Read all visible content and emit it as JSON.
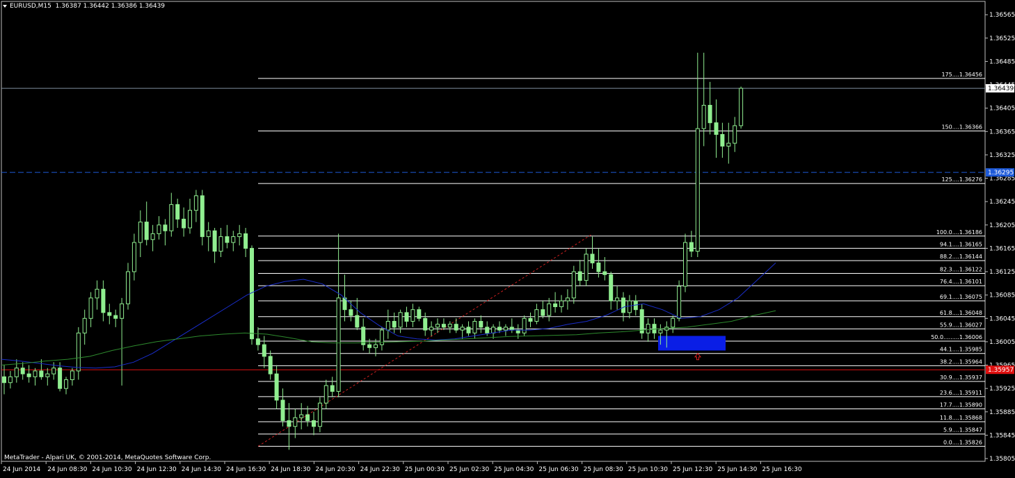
{
  "header": {
    "symbol": "EURUSD,M15",
    "ohlc": "1.36387 1.36442 1.36386 1.36439"
  },
  "copyright": "MetaTrader - Alpari UK, © 2001-2014, MetaQuotes Software Corp.",
  "colors": {
    "background": "#000000",
    "grid": "#ffffff",
    "candle": "#90ee90",
    "ma_fast": "#1a2ecc",
    "ma_slow": "#2e8b2e",
    "bid_line": "#8090a0",
    "alert_line": "#1e5ad8",
    "red_line": "#e01010",
    "trend_line": "#d02020",
    "fib_lines": "#ffffff",
    "zone": "#0a1ee6",
    "arrow": "#e02020"
  },
  "chart_data": {
    "type": "candlestick",
    "symbol": "EURUSD",
    "timeframe": "M15",
    "ylim": [
      1.35805,
      1.3657
    ],
    "y_ticks": [
      "1.36565",
      "1.36525",
      "1.36485",
      "1.36445",
      "1.36405",
      "1.36365",
      "1.36325",
      "1.36285",
      "1.36245",
      "1.36205",
      "1.36165",
      "1.36125",
      "1.36085",
      "1.36045",
      "1.36005",
      "1.35965",
      "1.35925",
      "1.35885",
      "1.35845",
      "1.35805"
    ],
    "x_labels": [
      "24 Jun 2014",
      "24 Jun 08:30",
      "24 Jun 10:30",
      "24 Jun 12:30",
      "24 Jun 14:30",
      "24 Jun 16:30",
      "24 Jun 18:30",
      "24 Jun 20:30",
      "24 Jun 22:30",
      "25 Jun 00:30",
      "25 Jun 02:30",
      "25 Jun 04:30",
      "25 Jun 06:30",
      "25 Jun 08:30",
      "25 Jun 10:30",
      "25 Jun 12:30",
      "25 Jun 14:30",
      "25 Jun 16:30"
    ],
    "price_boxes": [
      {
        "label": "1.36439",
        "price": 1.36439,
        "bg": "#ffffff",
        "fg": "#000000"
      },
      {
        "label": "1.36295",
        "price": 1.36295,
        "bg": "#1e5ad8",
        "fg": "#ffffff"
      },
      {
        "label": "1.35957",
        "price": 1.35957,
        "bg": "#e01010",
        "fg": "#ffffff"
      }
    ],
    "horizontal_lines": {
      "bid": 1.36439,
      "alert": 1.36295,
      "red": 1.35957
    },
    "fibonacci": [
      {
        "label": "175....1.36456",
        "price": 1.36456
      },
      {
        "label": "150....1.36366",
        "price": 1.36366
      },
      {
        "label": "125....1.36276",
        "price": 1.36276
      },
      {
        "label": "100.0....1.36186",
        "price": 1.36186
      },
      {
        "label": "94.1....1.36165",
        "price": 1.36165
      },
      {
        "label": "88.2....1.36144",
        "price": 1.36144
      },
      {
        "label": "82.3....1.36122",
        "price": 1.36122
      },
      {
        "label": "76.4....1.36101",
        "price": 1.36101
      },
      {
        "label": "69.1....1.36075",
        "price": 1.36075
      },
      {
        "label": "61.8....1.36048",
        "price": 1.36048
      },
      {
        "label": "55.9....1.36027",
        "price": 1.36027
      },
      {
        "label": "50.0.........1.36006",
        "price": 1.36006
      },
      {
        "label": "44.1....1.35985",
        "price": 1.35985
      },
      {
        "label": "38.2....1.35964",
        "price": 1.35964
      },
      {
        "label": "30.9....1.35937",
        "price": 1.35937
      },
      {
        "label": "23.6....1.35911",
        "price": 1.35911
      },
      {
        "label": "17.7....1.35890",
        "price": 1.3589
      },
      {
        "label": "11.8....1.35868",
        "price": 1.35868
      },
      {
        "label": "5.9....1.35847",
        "price": 1.35847
      },
      {
        "label": "0.0....1.35826",
        "price": 1.35826
      }
    ],
    "candles": [
      [
        1.35945,
        1.35965,
        1.35915,
        1.35935
      ],
      [
        1.35935,
        1.35955,
        1.35925,
        1.35945
      ],
      [
        1.35945,
        1.35975,
        1.35935,
        1.3596
      ],
      [
        1.3596,
        1.3597,
        1.3594,
        1.3595
      ],
      [
        1.3595,
        1.35965,
        1.35935,
        1.35945
      ],
      [
        1.35945,
        1.3596,
        1.3593,
        1.35955
      ],
      [
        1.35955,
        1.35975,
        1.3594,
        1.35945
      ],
      [
        1.35945,
        1.3596,
        1.3593,
        1.3595
      ],
      [
        1.3595,
        1.3597,
        1.3594,
        1.3596
      ],
      [
        1.3596,
        1.3597,
        1.3592,
        1.35925
      ],
      [
        1.35925,
        1.35945,
        1.35915,
        1.3594
      ],
      [
        1.3594,
        1.3596,
        1.3593,
        1.35955
      ],
      [
        1.35955,
        1.3603,
        1.3594,
        1.3602
      ],
      [
        1.3602,
        1.3606,
        1.36,
        1.36045
      ],
      [
        1.36045,
        1.3609,
        1.3603,
        1.3608
      ],
      [
        1.3608,
        1.3611,
        1.3606,
        1.36095
      ],
      [
        1.36095,
        1.3611,
        1.3604,
        1.36055
      ],
      [
        1.36055,
        1.3607,
        1.36035,
        1.3605
      ],
      [
        1.3605,
        1.3606,
        1.3603,
        1.36045
      ],
      [
        1.36045,
        1.3608,
        1.3593,
        1.3607
      ],
      [
        1.3607,
        1.3614,
        1.3606,
        1.36125
      ],
      [
        1.36125,
        1.3619,
        1.3611,
        1.36175
      ],
      [
        1.36175,
        1.3623,
        1.3615,
        1.3621
      ],
      [
        1.3621,
        1.36245,
        1.3617,
        1.3618
      ],
      [
        1.3618,
        1.36205,
        1.3616,
        1.3619
      ],
      [
        1.3619,
        1.3622,
        1.3618,
        1.36205
      ],
      [
        1.36205,
        1.36215,
        1.3617,
        1.36195
      ],
      [
        1.36195,
        1.3626,
        1.36185,
        1.3624
      ],
      [
        1.3624,
        1.3625,
        1.362,
        1.36215
      ],
      [
        1.36215,
        1.36235,
        1.36185,
        1.362
      ],
      [
        1.362,
        1.3625,
        1.3619,
        1.3623
      ],
      [
        1.3623,
        1.36265,
        1.3621,
        1.36255
      ],
      [
        1.36255,
        1.36265,
        1.3617,
        1.36185
      ],
      [
        1.36185,
        1.3621,
        1.3616,
        1.36195
      ],
      [
        1.36195,
        1.362,
        1.3614,
        1.3616
      ],
      [
        1.3616,
        1.362,
        1.3615,
        1.36185
      ],
      [
        1.36185,
        1.36205,
        1.36165,
        1.36175
      ],
      [
        1.36175,
        1.36195,
        1.3616,
        1.36185
      ],
      [
        1.36185,
        1.36205,
        1.3617,
        1.3619
      ],
      [
        1.3619,
        1.362,
        1.3615,
        1.36165
      ],
      [
        1.36165,
        1.3617,
        1.36,
        1.3601
      ],
      [
        1.3601,
        1.3603,
        1.3599,
        1.36
      ],
      [
        1.36,
        1.36015,
        1.3596,
        1.3598
      ],
      [
        1.3598,
        1.3599,
        1.3594,
        1.3595
      ],
      [
        1.3595,
        1.35965,
        1.3589,
        1.35905
      ],
      [
        1.35905,
        1.35925,
        1.3586,
        1.3587
      ],
      [
        1.3587,
        1.359,
        1.3582,
        1.3586
      ],
      [
        1.3586,
        1.3589,
        1.3584,
        1.35875
      ],
      [
        1.35875,
        1.359,
        1.35855,
        1.3588
      ],
      [
        1.3588,
        1.35895,
        1.3586,
        1.3587
      ],
      [
        1.3587,
        1.35885,
        1.35845,
        1.3586
      ],
      [
        1.3586,
        1.3591,
        1.3585,
        1.359
      ],
      [
        1.359,
        1.3594,
        1.3589,
        1.3593
      ],
      [
        1.3593,
        1.35945,
        1.3591,
        1.3592
      ],
      [
        1.3592,
        1.3619,
        1.3591,
        1.3608
      ],
      [
        1.3608,
        1.3612,
        1.3604,
        1.3606
      ],
      [
        1.3606,
        1.36075,
        1.3604,
        1.3605
      ],
      [
        1.3605,
        1.3608,
        1.36025,
        1.3603
      ],
      [
        1.3603,
        1.36045,
        1.3599,
        1.36
      ],
      [
        1.36,
        1.3601,
        1.35985,
        1.35995
      ],
      [
        1.35995,
        1.3601,
        1.3598,
        1.36
      ],
      [
        1.36,
        1.3603,
        1.3599,
        1.36025
      ],
      [
        1.36025,
        1.3606,
        1.3601,
        1.3604
      ],
      [
        1.3604,
        1.36055,
        1.3602,
        1.3603
      ],
      [
        1.3603,
        1.3606,
        1.3602,
        1.36055
      ],
      [
        1.36055,
        1.36065,
        1.3603,
        1.3604
      ],
      [
        1.3604,
        1.3607,
        1.3603,
        1.3606
      ],
      [
        1.3606,
        1.36065,
        1.3604,
        1.36045
      ],
      [
        1.36045,
        1.36055,
        1.36015,
        1.36025
      ],
      [
        1.36025,
        1.3604,
        1.36015,
        1.3603
      ],
      [
        1.3603,
        1.36045,
        1.3602,
        1.36035
      ],
      [
        1.36035,
        1.36045,
        1.36025,
        1.3603
      ],
      [
        1.3603,
        1.3604,
        1.3602,
        1.36035
      ],
      [
        1.36035,
        1.36045,
        1.3602,
        1.36025
      ],
      [
        1.36025,
        1.36035,
        1.3601,
        1.3603
      ],
      [
        1.3603,
        1.3604,
        1.36015,
        1.3602
      ],
      [
        1.3602,
        1.36045,
        1.3601,
        1.3604
      ],
      [
        1.3604,
        1.3605,
        1.3602,
        1.3603
      ],
      [
        1.3603,
        1.3604,
        1.36015,
        1.3602
      ],
      [
        1.3602,
        1.36035,
        1.3601,
        1.3603
      ],
      [
        1.3603,
        1.3604,
        1.3602,
        1.36025
      ],
      [
        1.36025,
        1.36035,
        1.36015,
        1.3603
      ],
      [
        1.3603,
        1.36045,
        1.3602,
        1.36025
      ],
      [
        1.36025,
        1.36035,
        1.3601,
        1.3602
      ],
      [
        1.3602,
        1.3605,
        1.36015,
        1.36045
      ],
      [
        1.36045,
        1.36055,
        1.3603,
        1.3604
      ],
      [
        1.3604,
        1.3607,
        1.36035,
        1.3606
      ],
      [
        1.3606,
        1.36075,
        1.36045,
        1.3605
      ],
      [
        1.3605,
        1.3608,
        1.3604,
        1.3607
      ],
      [
        1.3607,
        1.3609,
        1.36055,
        1.36065
      ],
      [
        1.36065,
        1.36085,
        1.36055,
        1.36075
      ],
      [
        1.36075,
        1.36095,
        1.3606,
        1.3608
      ],
      [
        1.3608,
        1.36135,
        1.3607,
        1.36125
      ],
      [
        1.36125,
        1.36145,
        1.361,
        1.3611
      ],
      [
        1.3611,
        1.36165,
        1.361,
        1.36155
      ],
      [
        1.36155,
        1.36185,
        1.3613,
        1.3614
      ],
      [
        1.3614,
        1.36165,
        1.36115,
        1.36125
      ],
      [
        1.36125,
        1.3615,
        1.3611,
        1.3612
      ],
      [
        1.3612,
        1.36125,
        1.3606,
        1.36075
      ],
      [
        1.36075,
        1.361,
        1.3606,
        1.3608
      ],
      [
        1.3608,
        1.3609,
        1.3604,
        1.36055
      ],
      [
        1.36055,
        1.36085,
        1.36045,
        1.36075
      ],
      [
        1.36075,
        1.36085,
        1.3605,
        1.3606
      ],
      [
        1.3606,
        1.3607,
        1.3601,
        1.3602
      ],
      [
        1.3602,
        1.36045,
        1.36005,
        1.36035
      ],
      [
        1.36035,
        1.36045,
        1.3601,
        1.3602
      ],
      [
        1.3602,
        1.36035,
        1.36,
        1.36025
      ],
      [
        1.36025,
        1.3604,
        1.35995,
        1.3603
      ],
      [
        1.3603,
        1.3605,
        1.3602,
        1.36045
      ],
      [
        1.36045,
        1.3611,
        1.3604,
        1.361
      ],
      [
        1.361,
        1.3619,
        1.3609,
        1.36175
      ],
      [
        1.36175,
        1.36195,
        1.3615,
        1.3616
      ],
      [
        1.3616,
        1.365,
        1.3615,
        1.3637
      ],
      [
        1.3637,
        1.365,
        1.3634,
        1.3641
      ],
      [
        1.3641,
        1.3645,
        1.3636,
        1.3638
      ],
      [
        1.3638,
        1.3642,
        1.3632,
        1.3636
      ],
      [
        1.3636,
        1.3638,
        1.3632,
        1.3634
      ],
      [
        1.3634,
        1.3638,
        1.3631,
        1.36345
      ],
      [
        1.36345,
        1.3639,
        1.3633,
        1.36375
      ],
      [
        1.36375,
        1.36442,
        1.3637,
        1.36439
      ]
    ],
    "ma_fast": [
      1.35975,
      1.35972,
      1.35968,
      1.35964,
      1.35961,
      1.3596,
      1.35962,
      1.3597,
      1.35985,
      1.36005,
      1.36025,
      1.36045,
      1.36065,
      1.36085,
      1.361,
      1.36108,
      1.36112,
      1.36104,
      1.36085,
      1.36055,
      1.36033,
      1.36015,
      1.3601,
      1.36008,
      1.3601,
      1.36015,
      1.3602,
      1.36025,
      1.36025,
      1.36028,
      1.36035,
      1.3604,
      1.3605,
      1.36065,
      1.3607,
      1.3606,
      1.36045,
      1.36048,
      1.3606,
      1.3608,
      1.3611,
      1.3614
    ],
    "ma_slow": [
      1.35965,
      1.35968,
      1.35972,
      1.35975,
      1.3598,
      1.3599,
      1.35998,
      1.36005,
      1.3601,
      1.36015,
      1.36018,
      1.3602,
      1.36018,
      1.36012,
      1.36005,
      1.36003,
      1.36003,
      1.36004,
      1.36005,
      1.36006,
      1.36008,
      1.3601,
      1.36012,
      1.36014,
      1.36015,
      1.36016,
      1.36017,
      1.3602,
      1.36022,
      1.36025,
      1.36028,
      1.3603,
      1.36035,
      1.3604,
      1.3605,
      1.36058
    ]
  }
}
